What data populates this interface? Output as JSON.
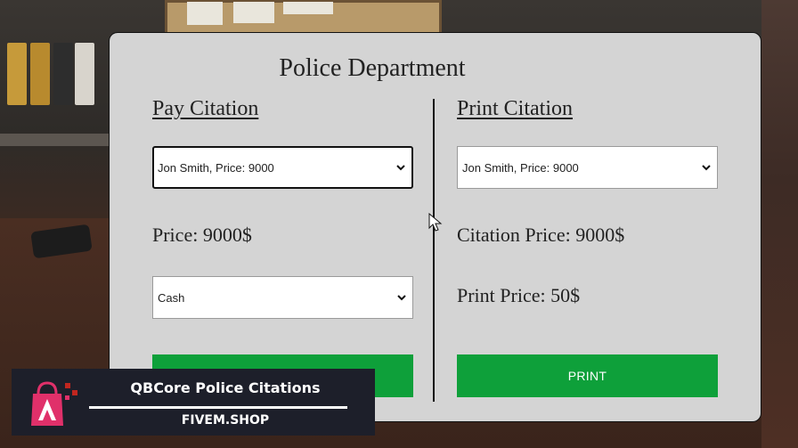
{
  "panel": {
    "title": "Police Department"
  },
  "pay": {
    "heading": "Pay Citation",
    "citation_select": {
      "value": "Jon Smith, Price: 9000"
    },
    "price_label": "Price: 9000$",
    "method_select": {
      "value": "Cash"
    },
    "button_label": ""
  },
  "print": {
    "heading": "Print Citation",
    "citation_select": {
      "value": "Jon Smith, Price: 9000"
    },
    "citation_price_label": "Citation Price: 9000$",
    "print_price_label": "Print Price: 50$",
    "button_label": "PRINT"
  },
  "badge": {
    "title": "QBCore Police Citations",
    "subtitle": "FIVEM.SHOP"
  },
  "colors": {
    "panel_bg": "#d4d4d4",
    "button_green": "#0ea03a",
    "badge_bg": "#1d1f2a",
    "logo_pink": "#e0306a",
    "logo_red": "#c0261f"
  },
  "icons": {
    "select_arrow": "chevron-down-icon",
    "cursor": "mouse-cursor-icon",
    "logo": "shopping-bag-logo-icon"
  }
}
